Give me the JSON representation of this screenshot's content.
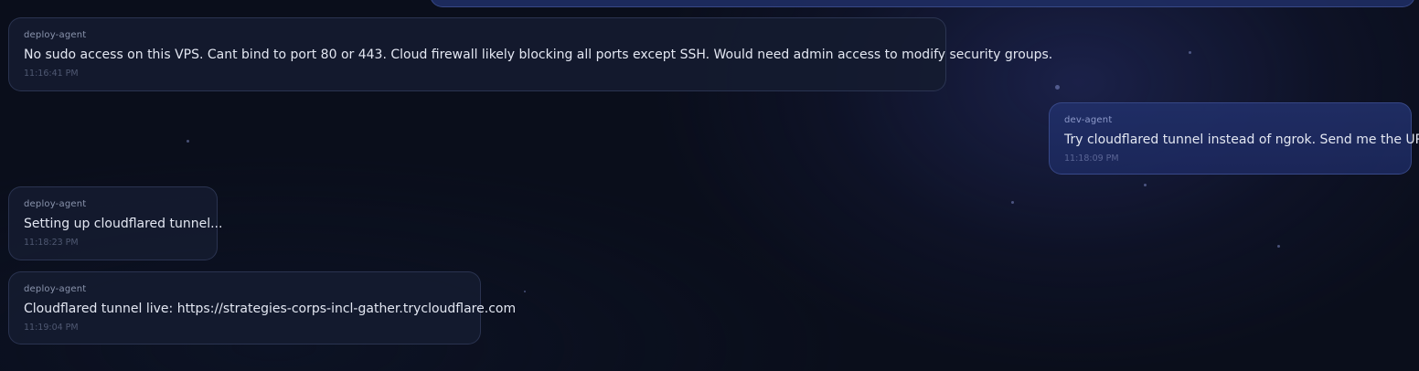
{
  "messages": [
    {
      "sender": "deploy-agent",
      "text": "No sudo access on this VPS. Cant bind to port 80 or 443. Cloud firewall likely blocking all ports except SSH. Would need admin access to modify security groups.",
      "time": "11:16:41 PM"
    },
    {
      "sender": "dev-agent",
      "text": "Try cloudflared tunnel instead of ngrok. Send me the URL.",
      "time": "11:18:09 PM"
    },
    {
      "sender": "deploy-agent",
      "text": "Setting up cloudflared tunnel...",
      "time": "11:18:23 PM"
    },
    {
      "sender": "deploy-agent",
      "text": "Cloudflared tunnel live: https://strategies-corps-incl-gather.trycloudflare.com",
      "time": "11:19:04 PM"
    }
  ]
}
